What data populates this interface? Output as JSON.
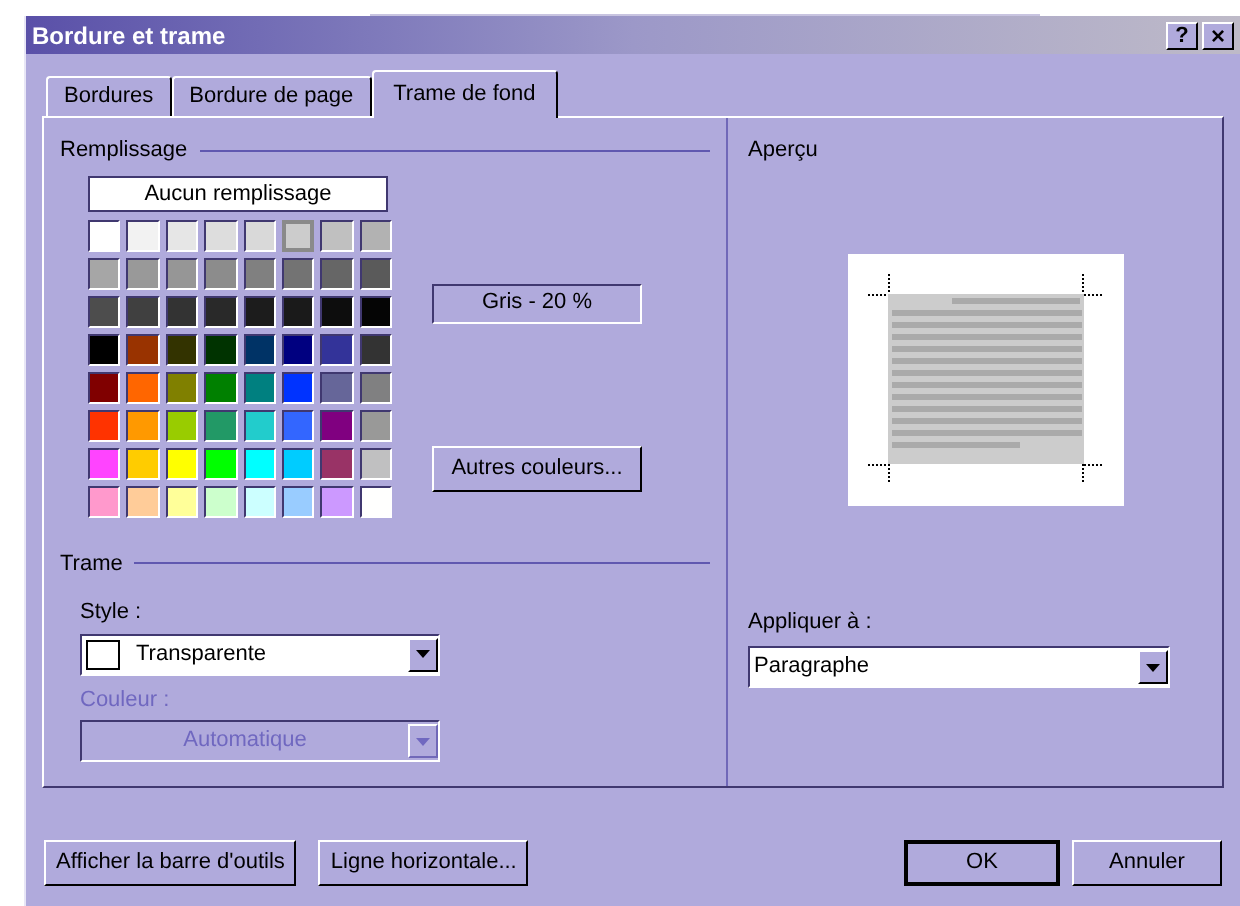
{
  "window": {
    "title": "Bordure et trame",
    "help_button": "?",
    "close_button": "×"
  },
  "tabs": [
    {
      "label": "Bordures",
      "selected": false
    },
    {
      "label": "Bordure de page",
      "selected": false
    },
    {
      "label": "Trame de fond",
      "selected": true
    }
  ],
  "fill": {
    "label": "Remplissage",
    "no_fill_button": "Aucun remplissage",
    "selected_name": "Gris - 20 %",
    "more_colors_button": "Autres couleurs...",
    "swatches": [
      {
        "color": "#ffffff",
        "selected": false
      },
      {
        "color": "#f2f2f2",
        "selected": false
      },
      {
        "color": "#e6e6e6",
        "selected": false
      },
      {
        "color": "#dddddd",
        "selected": false
      },
      {
        "color": "#d9d9d9",
        "selected": false
      },
      {
        "color": "#cccccc",
        "selected": true
      },
      {
        "color": "#c0c0c0",
        "selected": false
      },
      {
        "color": "#b2b2b2",
        "selected": false
      },
      {
        "color": "#a6a6a6",
        "selected": false
      },
      {
        "color": "#999999",
        "selected": false
      },
      {
        "color": "#969696",
        "selected": false
      },
      {
        "color": "#8c8c8c",
        "selected": false
      },
      {
        "color": "#808080",
        "selected": false
      },
      {
        "color": "#737373",
        "selected": false
      },
      {
        "color": "#666666",
        "selected": false
      },
      {
        "color": "#5a5a5a",
        "selected": false
      },
      {
        "color": "#4d4d4d",
        "selected": false
      },
      {
        "color": "#404040",
        "selected": false
      },
      {
        "color": "#333333",
        "selected": false
      },
      {
        "color": "#292929",
        "selected": false
      },
      {
        "color": "#1c1c1c",
        "selected": false
      },
      {
        "color": "#1a1a1a",
        "selected": false
      },
      {
        "color": "#0d0d0d",
        "selected": false
      },
      {
        "color": "#050505",
        "selected": false
      },
      {
        "color": "#000000",
        "selected": false
      },
      {
        "color": "#993300",
        "selected": false
      },
      {
        "color": "#333300",
        "selected": false
      },
      {
        "color": "#003300",
        "selected": false
      },
      {
        "color": "#003366",
        "selected": false
      },
      {
        "color": "#000080",
        "selected": false
      },
      {
        "color": "#333399",
        "selected": false
      },
      {
        "color": "#333333",
        "selected": false
      },
      {
        "color": "#800000",
        "selected": false
      },
      {
        "color": "#ff6600",
        "selected": false
      },
      {
        "color": "#808000",
        "selected": false
      },
      {
        "color": "#008000",
        "selected": false
      },
      {
        "color": "#008080",
        "selected": false
      },
      {
        "color": "#0033ff",
        "selected": false
      },
      {
        "color": "#666699",
        "selected": false
      },
      {
        "color": "#808081",
        "selected": false
      },
      {
        "color": "#ff3300",
        "selected": false
      },
      {
        "color": "#ff9900",
        "selected": false
      },
      {
        "color": "#99cc00",
        "selected": false
      },
      {
        "color": "#229966",
        "selected": false
      },
      {
        "color": "#22cccc",
        "selected": false
      },
      {
        "color": "#3366ff",
        "selected": false
      },
      {
        "color": "#800080",
        "selected": false
      },
      {
        "color": "#999998",
        "selected": false
      },
      {
        "color": "#ff44ff",
        "selected": false
      },
      {
        "color": "#ffcc00",
        "selected": false
      },
      {
        "color": "#ffff00",
        "selected": false
      },
      {
        "color": "#00ff00",
        "selected": false
      },
      {
        "color": "#00ffff",
        "selected": false
      },
      {
        "color": "#00ccff",
        "selected": false
      },
      {
        "color": "#993366",
        "selected": false
      },
      {
        "color": "#c0c0c1",
        "selected": false
      },
      {
        "color": "#ff99cc",
        "selected": false
      },
      {
        "color": "#ffcc99",
        "selected": false
      },
      {
        "color": "#ffff99",
        "selected": false
      },
      {
        "color": "#ccffcc",
        "selected": false
      },
      {
        "color": "#ccffff",
        "selected": false
      },
      {
        "color": "#99ccff",
        "selected": false
      },
      {
        "color": "#cc99ff",
        "selected": false
      },
      {
        "color": "#fffffe",
        "selected": false
      }
    ]
  },
  "pattern": {
    "label": "Trame",
    "style_label": "Style :",
    "style_value": "Transparente",
    "color_label": "Couleur :",
    "color_value": "Automatique",
    "color_disabled": true
  },
  "preview": {
    "label": "Aperçu",
    "apply_label": "Appliquer à :",
    "apply_value": "Paragraphe"
  },
  "buttons": [
    {
      "label": "Afficher la barre d'outils",
      "kind": "left"
    },
    {
      "label": "Ligne horizontale...",
      "kind": "left"
    },
    {
      "label": "OK",
      "kind": "default"
    },
    {
      "label": "Annuler",
      "kind": "right"
    }
  ]
}
